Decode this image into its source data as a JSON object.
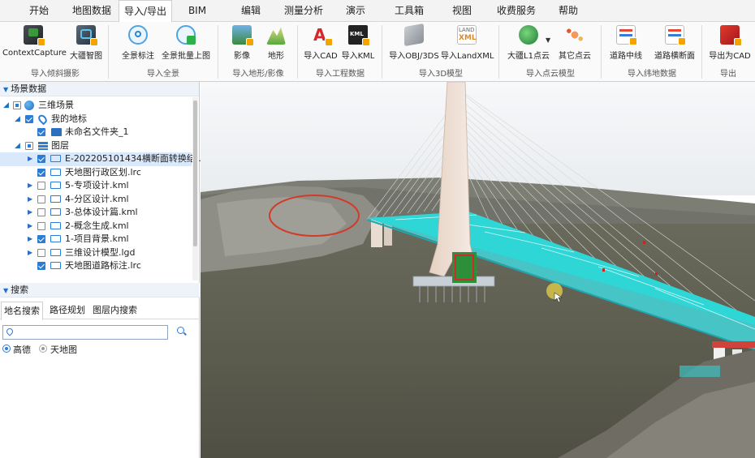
{
  "menu": [
    "开始",
    "地图数据",
    "导入/导出",
    "BIM",
    "编辑",
    "测量分析",
    "演示",
    "工具箱",
    "视图",
    "收费服务",
    "帮助"
  ],
  "ribbon": {
    "buttons": [
      "ContextCapture",
      "大疆智图",
      "全景标注",
      "全景批量上图",
      "影像",
      "地形",
      "导入CAD",
      "导入KML",
      "导入OBJ/3DS",
      "导入LandXML",
      "大疆L1点云",
      "其它点云",
      "道路中线",
      "道路横断面",
      "导出为CAD"
    ],
    "groups": [
      "导入倾斜摄影",
      "导入全景",
      "导入地形/影像",
      "导入工程数据",
      "导入3D模型",
      "导入点云模型",
      "导入纬地数据",
      "导出"
    ],
    "icon_names": [
      "contextcapture-icon",
      "dji-terra-icon",
      "panorama-label-icon",
      "panorama-batch-icon",
      "imagery-icon",
      "terrain-icon",
      "cad-icon",
      "kml-icon",
      "obj-icon",
      "landxml-icon",
      "dji-l1-icon",
      "pointcloud-icon",
      "road-centerline-icon",
      "road-section-icon",
      "export-cad-icon"
    ],
    "landxml_icon_text": [
      "LAND",
      "XML"
    ],
    "kml_icon_text": "KML"
  },
  "panel": {
    "scene_title": "场景数据",
    "tree": [
      {
        "label": "三维场景",
        "checked": "partial",
        "icon": "globe-icon"
      },
      {
        "label": "我的地标",
        "checked": "on",
        "icon": "pin-icon"
      },
      {
        "label": "未命名文件夹_1",
        "checked": "on",
        "icon": "folder-icon"
      },
      {
        "label": "图层",
        "checked": "partial",
        "icon": "layers-icon"
      },
      {
        "label": "E-20220510143​4横断面转换结...",
        "checked": "on",
        "icon": "monitor-icon"
      },
      {
        "label": "天地图行政区划.lrc",
        "checked": "on",
        "icon": "monitor-icon"
      },
      {
        "label": "5-专项设计.kml",
        "checked": "off",
        "icon": "monitor-icon"
      },
      {
        "label": "4-分区设计.kml",
        "checked": "off",
        "icon": "monitor-icon"
      },
      {
        "label": "3-总体设计篇.kml",
        "checked": "off",
        "icon": "monitor-icon"
      },
      {
        "label": "2-概念生成.kml",
        "checked": "off",
        "icon": "monitor-icon"
      },
      {
        "label": "1-项目背景.kml",
        "checked": "on",
        "icon": "monitor-icon"
      },
      {
        "label": "三维设计模型.lgd",
        "checked": "off",
        "icon": "monitor-icon"
      },
      {
        "label": "天地图道路标注.lrc",
        "checked": "on",
        "icon": "monitor-icon"
      }
    ],
    "search_title": "搜索",
    "search_tabs": [
      "地名搜索",
      "路径规划",
      "图层内搜索"
    ],
    "search_placeholder": "",
    "providers": [
      "高德",
      "天地图"
    ]
  },
  "colors": {
    "accent": "#2b7cd3",
    "bridge_deck": "#2fd6d6",
    "water": "#5a5a4e",
    "sky": "#f4f6f8"
  }
}
